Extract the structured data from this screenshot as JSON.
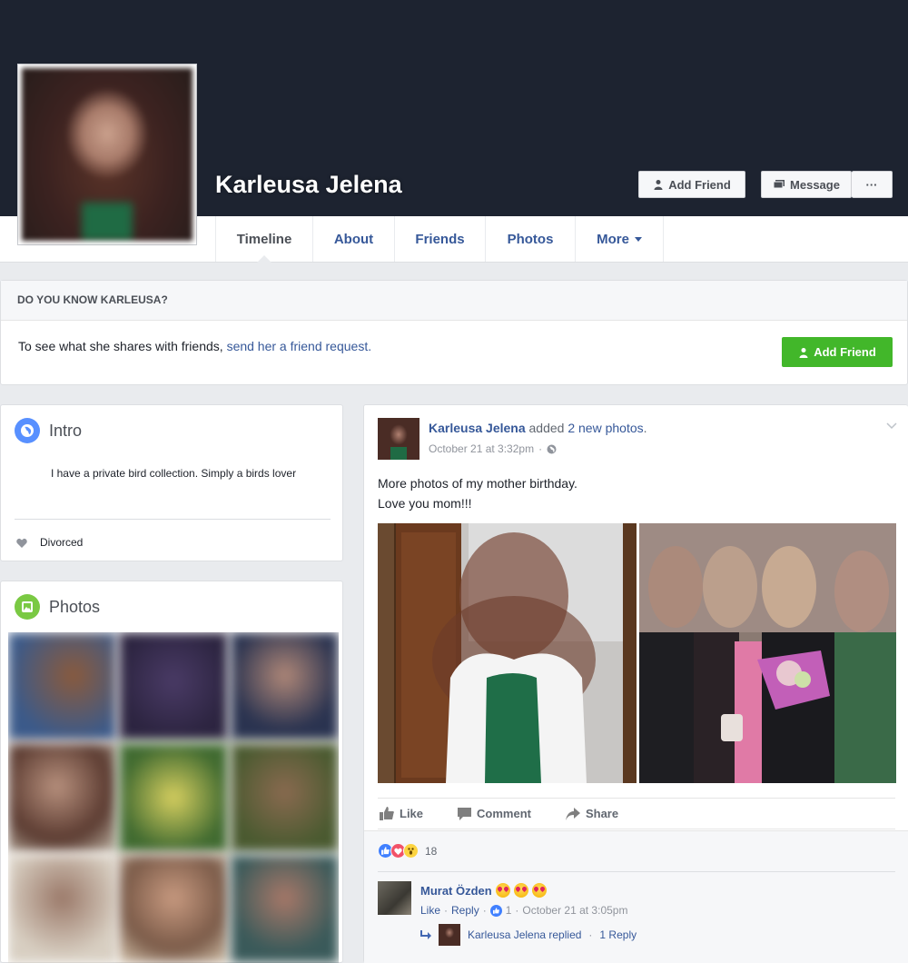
{
  "profile": {
    "name": "Karleusa Jelena",
    "add_friend_label": "Add Friend",
    "message_label": "Message",
    "more_dots": "···"
  },
  "nav": {
    "tabs": [
      {
        "label": "Timeline",
        "active": true
      },
      {
        "label": "About"
      },
      {
        "label": "Friends"
      },
      {
        "label": "Photos"
      },
      {
        "label": "More"
      }
    ]
  },
  "know_panel": {
    "heading": "DO YOU KNOW KARLEUSA?",
    "text_prefix": "To see what she shares with friends, ",
    "link_text": "send her a friend request.",
    "button_label": "Add Friend"
  },
  "intro": {
    "title": "Intro",
    "bio": "I have a private bird collection. Simply a birds lover",
    "relationship": "Divorced"
  },
  "photos_section": {
    "title": "Photos"
  },
  "post": {
    "author": "Karleusa Jelena",
    "action_text": " added ",
    "photos_link": "2 new photos",
    "action_end": ".",
    "timestamp": "October 21 at 3:32pm",
    "dot": "·",
    "text_line1": "More photos of my mother birthday.",
    "text_line2": "Love you mom!!!",
    "actions": {
      "like": "Like",
      "comment": "Comment",
      "share": "Share"
    },
    "reaction_count": "18"
  },
  "comment": {
    "author": "Murat Özden",
    "like": "Like",
    "sep1": "·",
    "reply": "Reply",
    "sep2": "·",
    "likes": "1",
    "sep3": "·",
    "timestamp": "October 21 at 3:05pm",
    "reply_summary_author": "Karleusa Jelena replied",
    "reply_summary_sep": "·",
    "reply_summary_count": "1 Reply"
  },
  "colors": {
    "cover": "#1d2330",
    "link": "#365899",
    "green_button": "#42b72a",
    "background": "#e9ebee"
  }
}
